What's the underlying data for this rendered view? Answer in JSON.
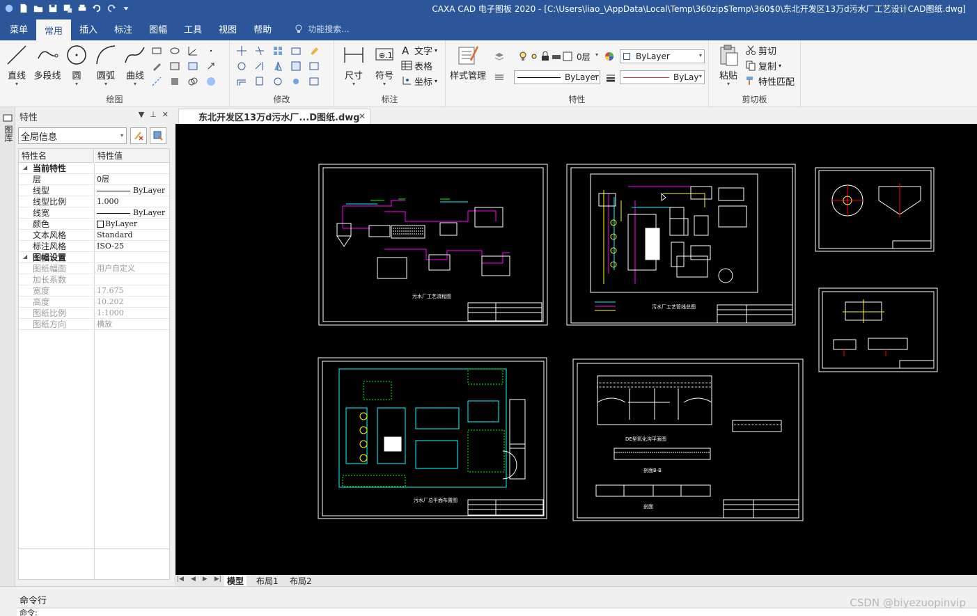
{
  "titlebar": {
    "title": "CAXA CAD 电子图板 2020 - [C:\\Users\\liao_\\AppData\\Local\\Temp\\360zip$Temp\\360$0\\东北开发区13万d污水厂工艺设计CAD图纸.dwg]",
    "qat_icons": [
      "app-icon",
      "new-icon",
      "open-icon",
      "save-icon",
      "save-as-icon",
      "print-icon",
      "undo-icon",
      "redo-icon",
      "customize-icon"
    ]
  },
  "ribbon_tabs": [
    {
      "label": "菜单"
    },
    {
      "label": "常用"
    },
    {
      "label": "插入"
    },
    {
      "label": "标注"
    },
    {
      "label": "图幅"
    },
    {
      "label": "工具"
    },
    {
      "label": "视图"
    },
    {
      "label": "帮助"
    }
  ],
  "search": {
    "placeholder": "功能搜索..."
  },
  "ribbon": {
    "draw": {
      "label": "绘图",
      "line": "直线",
      "polyline": "多段线",
      "circle": "圆",
      "arc": "圆弧",
      "curve": "曲线"
    },
    "modify": {
      "label": "修改"
    },
    "annotate": {
      "label": "标注",
      "dimension": "尺寸",
      "symbol": "符号",
      "text": "文字",
      "table": "表格",
      "coord": "坐标"
    },
    "properties": {
      "label": "特性",
      "style_manage": "样式管理",
      "layer": "0层",
      "color_combo": "ByLayer",
      "linetype_combo": "ByLayer",
      "lineweight_combo": "ByLay"
    },
    "clipboard": {
      "label": "剪切板",
      "paste": "粘贴",
      "cut": "剪切",
      "copy": "复制",
      "match": "特性匹配"
    }
  },
  "properties_panel": {
    "side_tab": "图库",
    "title": "特性",
    "combo": "全局信息",
    "col_name": "特性名",
    "col_value": "特性值",
    "sections": [
      {
        "title": "当前特性",
        "rows": [
          {
            "name": "层",
            "value": "0层"
          },
          {
            "name": "线型",
            "value": "ByLayer"
          },
          {
            "name": "线型比例",
            "value": "1.000"
          },
          {
            "name": "线宽",
            "value": "ByLayer"
          },
          {
            "name": "颜色",
            "value": "ByLayer"
          },
          {
            "name": "文本风格",
            "value": "Standard"
          },
          {
            "name": "标注风格",
            "value": "ISO-25"
          }
        ]
      },
      {
        "title": "图幅设置",
        "rows": [
          {
            "name": "图纸幅面",
            "value": "用户自定义"
          },
          {
            "name": "加长系数",
            "value": ""
          },
          {
            "name": "宽度",
            "value": "17.675"
          },
          {
            "name": "高度",
            "value": "10.202"
          },
          {
            "name": "图纸比例",
            "value": "1:1000"
          },
          {
            "name": "图纸方向",
            "value": "横放"
          }
        ]
      }
    ]
  },
  "document": {
    "tab_title": "东北开发区13万d污水厂...D图纸.dwg",
    "layout_tabs": [
      "模型",
      "布局1",
      "布局2"
    ],
    "drawing_titles": {
      "s1": "污水厂工艺流程图",
      "s2": "污水厂工艺管线总图",
      "s4": "污水厂总平面布置图",
      "s5a": "DE型氧化沟平面图",
      "s5b": "剖面B-B",
      "s5c": "剖面"
    }
  },
  "command": {
    "title": "命令行",
    "prompt": "命令:"
  },
  "watermark": "CSDN @biyezuopinvip",
  "colors": {
    "title_bar": "#2b579a",
    "canvas": "#000000",
    "cad_white": "#ffffff",
    "cad_magenta": "#ff00ff",
    "cad_cyan": "#00ffff",
    "cad_yellow": "#ffff00",
    "cad_green": "#00ff00",
    "cad_red": "#ff0000"
  }
}
